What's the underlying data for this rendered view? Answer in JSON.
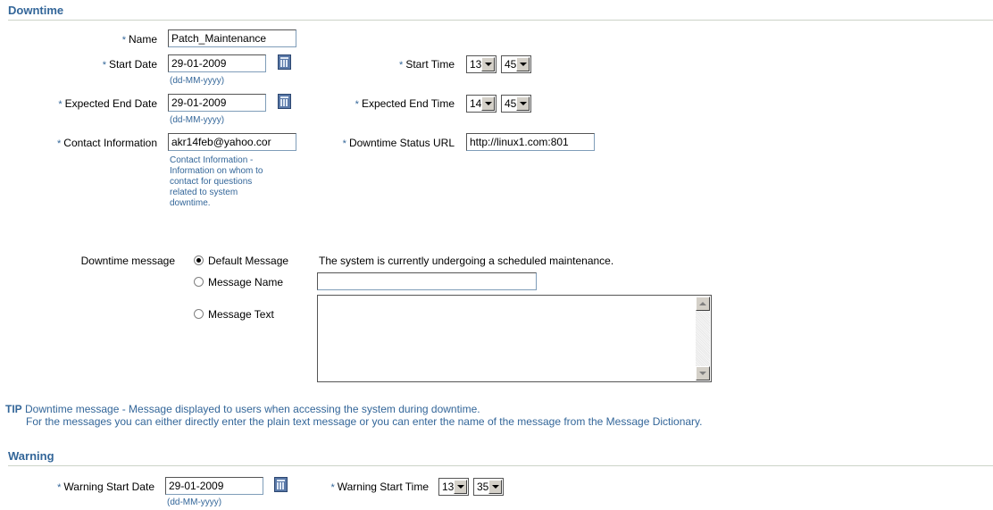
{
  "downtime": {
    "title": "Downtime",
    "name_label": "Name",
    "name_value": "Patch_Maintenance",
    "start_date_label": "Start Date",
    "start_date_value": "29-01-2009",
    "date_format_hint": "(dd-MM-yyyy)",
    "start_time_label": "Start Time",
    "start_hour": "13",
    "start_minute": "45",
    "end_date_label": "Expected End Date",
    "end_date_value": "29-01-2009",
    "end_time_label": "Expected End Time",
    "end_hour": "14",
    "end_minute": "45",
    "contact_label": "Contact Information",
    "contact_value": "akr14feb@yahoo.cor",
    "contact_hint": [
      "Contact Information -",
      "Information on whom to",
      "contact for questions",
      "related to system",
      "downtime."
    ],
    "status_url_label": "Downtime Status URL",
    "status_url_value": "http://linux1.com:801",
    "message_label": "Downtime message",
    "default_message_option": "Default Message",
    "default_message_text": "The system is currently undergoing a scheduled maintenance.",
    "message_name_option": "Message Name",
    "message_name_value": "",
    "message_text_option": "Message Text",
    "message_text_value": ""
  },
  "tip": {
    "prefix": "TIP",
    "line1": "Downtime message - Message displayed to users when accessing the system during downtime.",
    "line2": "For the messages you can either directly enter the plain text message or you can enter the name of the message from the Message Dictionary."
  },
  "warning": {
    "title": "Warning",
    "start_date_label": "Warning Start Date",
    "start_date_value": "29-01-2009",
    "date_format_hint": "(dd-MM-yyyy)",
    "start_time_label": "Warning Start Time",
    "start_hour": "13",
    "start_minute": "35"
  },
  "required_marker": "*",
  "colors": {
    "accent": "#336699",
    "divider": "#ccd3c8"
  },
  "icons": {
    "calendar": "calendar-icon",
    "dropdown": "chevron-down-icon"
  }
}
